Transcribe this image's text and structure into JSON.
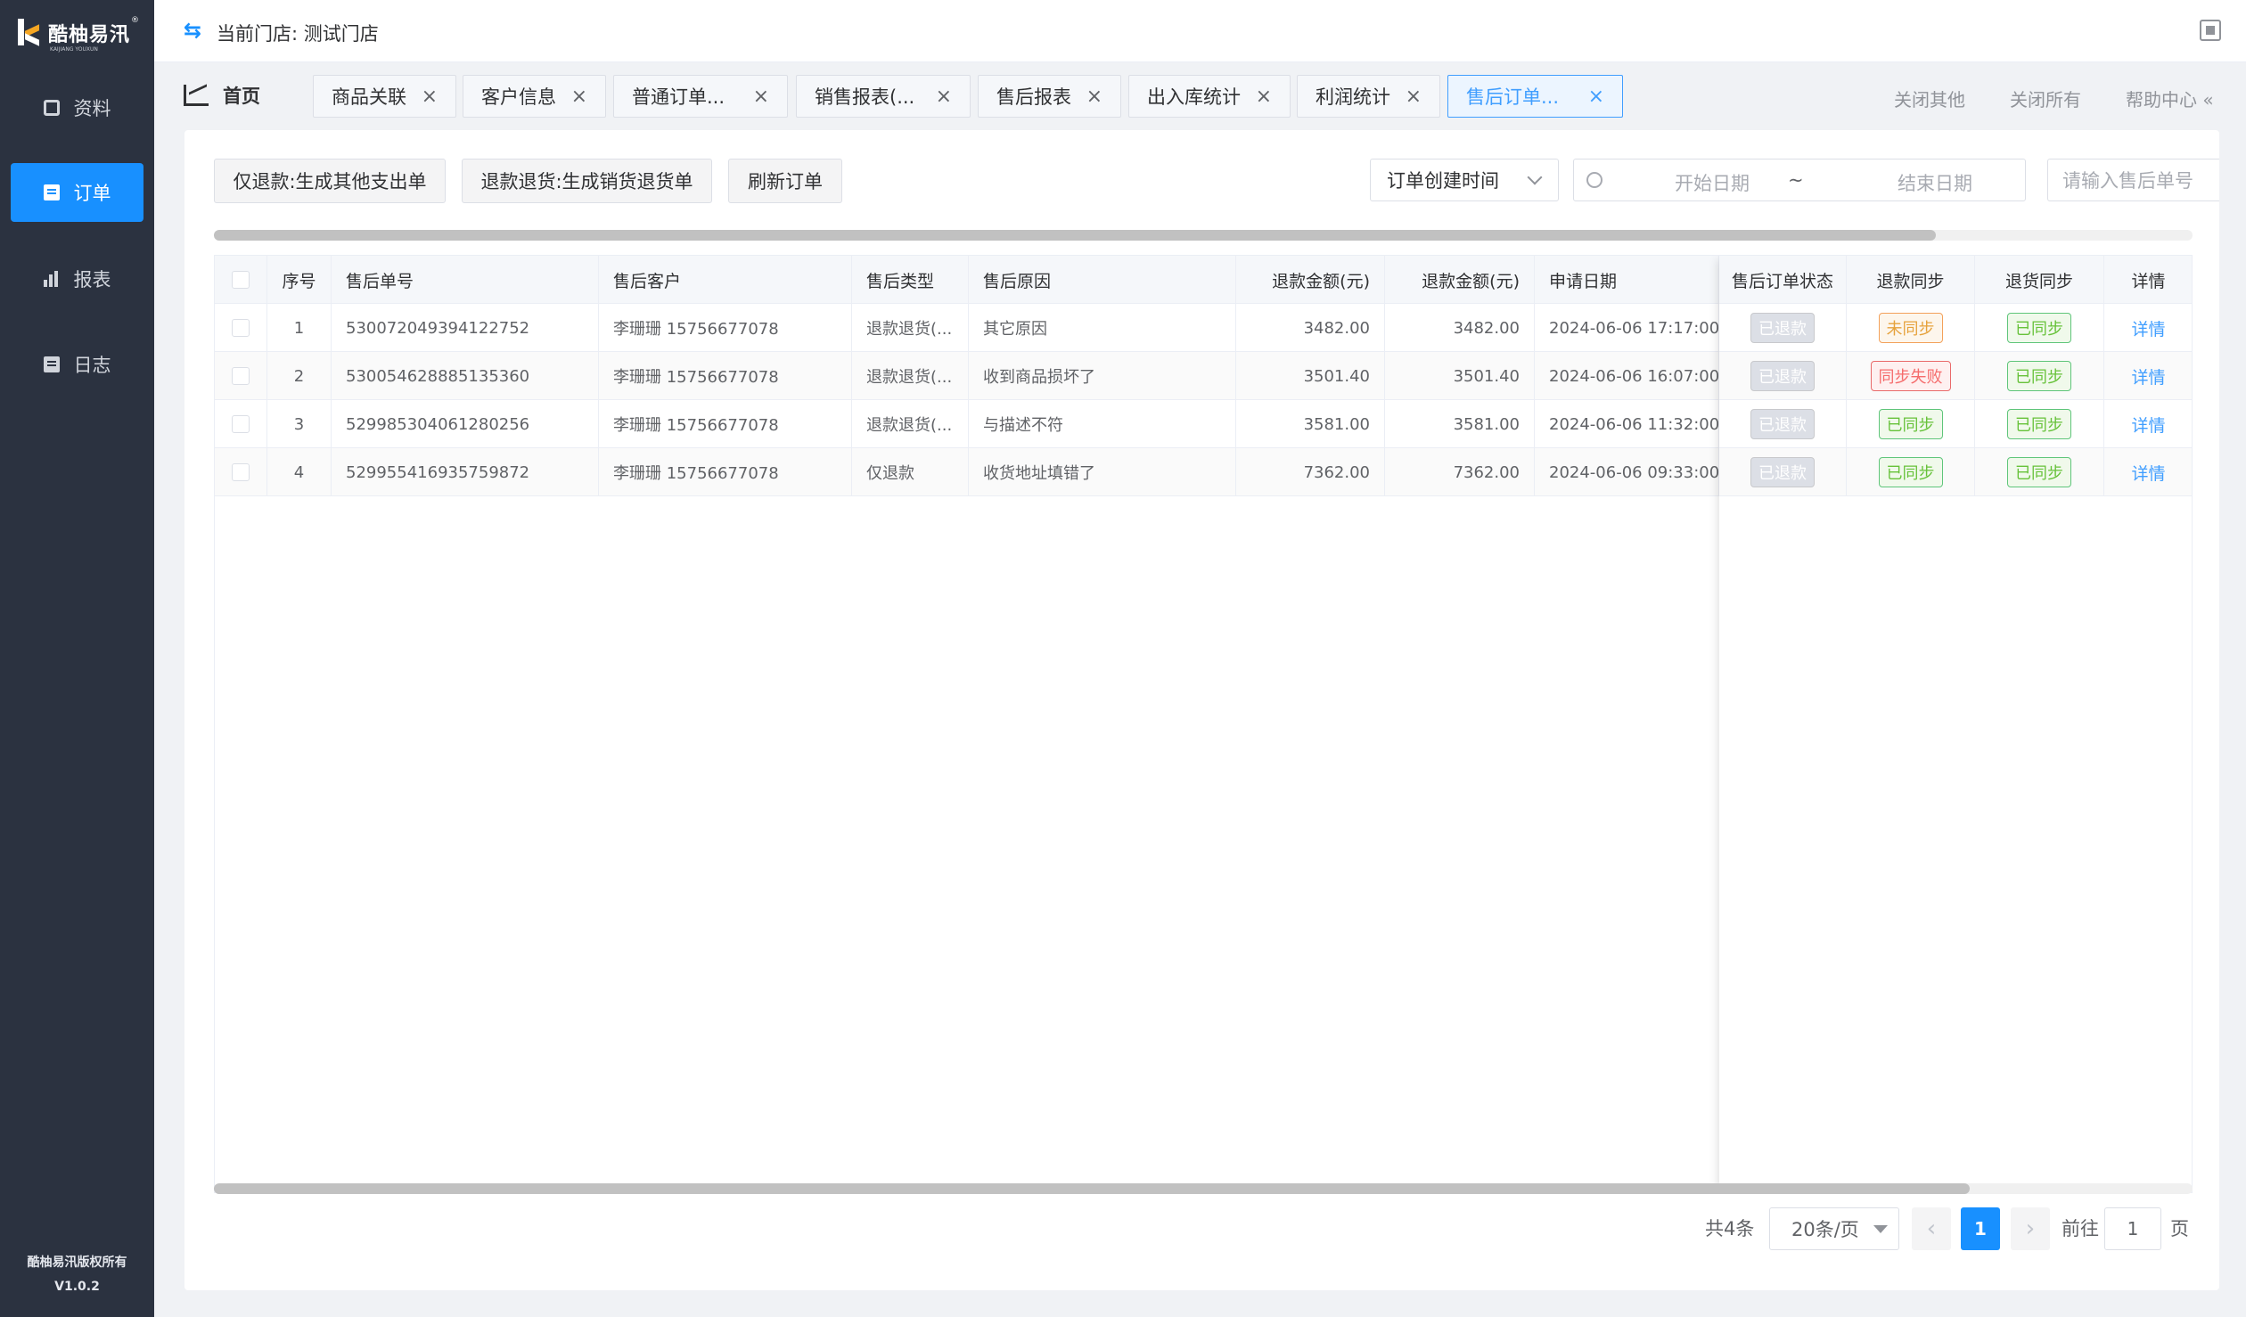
{
  "sidebar": {
    "logo_text": "酷柚易汛",
    "logo_sub": "KAIJIANG YOUXUN",
    "items": [
      {
        "label": "资料",
        "icon": "package-icon"
      },
      {
        "label": "订单",
        "icon": "document-icon",
        "active": true
      },
      {
        "label": "报表",
        "icon": "bar-chart-icon"
      },
      {
        "label": "日志",
        "icon": "log-icon"
      }
    ],
    "copyright": "酷柚易汛版权所有",
    "version": "V1.0.2"
  },
  "header": {
    "store_label": "当前门店: 测试门店"
  },
  "tabs": {
    "home": "首页",
    "items": [
      {
        "label": "商品关联"
      },
      {
        "label": "客户信息"
      },
      {
        "label": "普通订单..."
      },
      {
        "label": "销售报表(..."
      },
      {
        "label": "售后报表"
      },
      {
        "label": "出入库统计"
      },
      {
        "label": "利润统计"
      },
      {
        "label": "售后订单...",
        "active": true
      }
    ],
    "close_others": "关闭其他",
    "close_all": "关闭所有",
    "help": "帮助中心 «"
  },
  "toolbar": {
    "btn_refund_only": "仅退款:生成其他支出单",
    "btn_refund_return": "退款退货:生成销货退货单",
    "btn_refresh": "刷新订单",
    "date_type": "订单创建时间",
    "start_placeholder": "开始日期",
    "range_sep": "~",
    "end_placeholder": "结束日期",
    "search_placeholder": "请输入售后单号"
  },
  "table": {
    "headers": {
      "index": "序号",
      "order_no": "售后单号",
      "customer": "售后客户",
      "type": "售后类型",
      "reason": "售后原因",
      "refund_amount_1": "退款金额(元)",
      "refund_amount_2": "退款金额(元)",
      "apply_date": "申请日期",
      "status": "售后订单状态",
      "refund_sync": "退款同步",
      "return_sync": "退货同步",
      "detail": "详情"
    },
    "rows": [
      {
        "index": "1",
        "order_no": "530072049394122752",
        "customer": "李珊珊   15756677078",
        "type": "退款退货(...",
        "reason": "其它原因",
        "amount1": "3482.00",
        "amount2": "3482.00",
        "date": "2024-06-06 17:17:00",
        "status": "已退款",
        "refund_sync": "未同步",
        "refund_sync_kind": "warning",
        "return_sync": "已同步",
        "detail": "详情"
      },
      {
        "index": "2",
        "order_no": "530054628885135360",
        "customer": "李珊珊   15756677078",
        "type": "退款退货(...",
        "reason": "收到商品损坏了",
        "amount1": "3501.40",
        "amount2": "3501.40",
        "date": "2024-06-06 16:07:00",
        "status": "已退款",
        "refund_sync": "同步失败",
        "refund_sync_kind": "danger",
        "return_sync": "已同步",
        "detail": "详情"
      },
      {
        "index": "3",
        "order_no": "529985304061280256",
        "customer": "李珊珊   15756677078",
        "type": "退款退货(...",
        "reason": "与描述不符",
        "amount1": "3581.00",
        "amount2": "3581.00",
        "date": "2024-06-06 11:32:00",
        "status": "已退款",
        "refund_sync": "已同步",
        "refund_sync_kind": "success",
        "return_sync": "已同步",
        "detail": "详情"
      },
      {
        "index": "4",
        "order_no": "529955416935759872",
        "customer": "李珊珊   15756677078",
        "type": "仅退款",
        "reason": "收货地址填错了",
        "amount1": "7362.00",
        "amount2": "7362.00",
        "date": "2024-06-06 09:33:00",
        "status": "已退款",
        "refund_sync": "已同步",
        "refund_sync_kind": "success",
        "return_sync": "已同步",
        "detail": "详情"
      }
    ]
  },
  "pagination": {
    "total": "共4条",
    "page_size": "20条/页",
    "prev": "‹",
    "current": "1",
    "next": "›",
    "goto_label": "前往",
    "goto_value": "1",
    "page_suffix": "页"
  },
  "colors": {
    "primary": "#1890ff",
    "sidebar_bg": "#2b3240",
    "warning": "#e6a23c",
    "danger": "#f56c6c",
    "success": "#67c23a"
  }
}
